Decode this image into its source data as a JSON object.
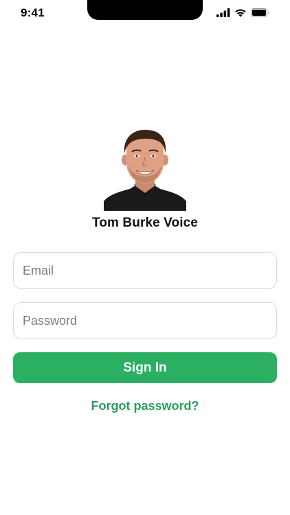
{
  "status_bar": {
    "time": "9:41",
    "icons": [
      "cellular-signal-icon",
      "wifi-icon",
      "battery-icon"
    ]
  },
  "profile": {
    "name": "Tom Burke Voice",
    "avatar": "profile-photo"
  },
  "form": {
    "email_placeholder": "Email",
    "email_value": "",
    "password_placeholder": "Password",
    "password_value": "",
    "sign_in_label": "Sign In",
    "forgot_password_label": "Forgot password?"
  },
  "colors": {
    "accent": "#2bb063",
    "link": "#2a9b5c",
    "field_border": "#d9d9d9",
    "background": "#ffffff"
  }
}
